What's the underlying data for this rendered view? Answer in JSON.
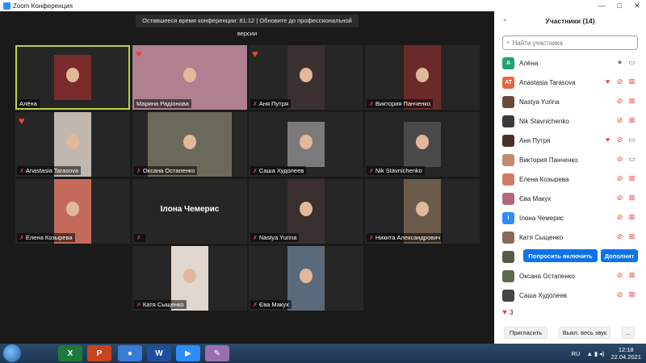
{
  "window": {
    "title": "Zoom Конференция",
    "controls": [
      "—",
      "□",
      "✕"
    ]
  },
  "banner": "Оставшееся время конференции: 81:12 | Обновите до профессиональной версии",
  "tiles": [
    {
      "name": "Алёна",
      "muted": false,
      "heart": false,
      "active": true,
      "pic": "small"
    },
    {
      "name": "Марина Радіонова",
      "muted": false,
      "heart": true,
      "active": false,
      "pic": "wide"
    },
    {
      "name": "Аня Путря",
      "muted": true,
      "heart": true,
      "active": false,
      "pic": "normal"
    },
    {
      "name": "Виктория Панченко",
      "muted": true,
      "heart": false,
      "active": false,
      "pic": "normal"
    },
    {
      "name": "Anastasia Tarasova",
      "muted": true,
      "heart": true,
      "active": false,
      "pic": "normal"
    },
    {
      "name": "Оксана Остапенко",
      "muted": true,
      "heart": false,
      "active": false,
      "pic": "mid"
    },
    {
      "name": "Саша Худолеев",
      "muted": true,
      "heart": false,
      "active": false,
      "pic": "small"
    },
    {
      "name": "Nik Stavnichenko",
      "muted": true,
      "heart": false,
      "active": false,
      "pic": "small"
    },
    {
      "name": "Елена Козырева",
      "muted": true,
      "heart": false,
      "active": false,
      "pic": "normal"
    },
    {
      "name": "",
      "bigname": "Ілона Чемерис",
      "muted": true,
      "heart": false,
      "active": false,
      "pic": "none"
    },
    {
      "name": "Nastya Yurina",
      "muted": true,
      "heart": false,
      "active": false,
      "pic": "normal"
    },
    {
      "name": "Никита Александрович",
      "muted": true,
      "heart": false,
      "active": false,
      "pic": "normal"
    },
    {
      "name": "Катя Сыщенко",
      "muted": true,
      "heart": false,
      "active": false,
      "pic": "normal"
    },
    {
      "name": "Єва Макух",
      "muted": true,
      "heart": false,
      "active": false,
      "pic": "normal"
    }
  ],
  "panel": {
    "title": "Участники (14)",
    "collapse_icon": "chevron-down-icon",
    "search_placeholder": "Найти участника",
    "participants": [
      {
        "name": "Алёна",
        "avatar_text": "A",
        "avatar_color": "#23a26d",
        "heart": false,
        "mic": "on",
        "cam": "on"
      },
      {
        "name": "Anastasia Tarasova",
        "avatar_text": "AT",
        "avatar_color": "#e8663c",
        "heart": true,
        "mic": "off",
        "cam": "off"
      },
      {
        "name": "Nastya Yurina",
        "avatar_text": "",
        "avatar_color": "#6b4a3a",
        "heart": false,
        "mic": "off",
        "cam": "off"
      },
      {
        "name": "Nik Stavnichenko",
        "avatar_text": "",
        "avatar_color": "#3a3a3a",
        "heart": false,
        "mic": "off",
        "cam": "off"
      },
      {
        "name": "Аня Путря",
        "avatar_text": "",
        "avatar_color": "#4a3028",
        "heart": true,
        "mic": "off",
        "cam": "on"
      },
      {
        "name": "Виктория Панченко",
        "avatar_text": "",
        "avatar_color": "#c48a70",
        "heart": false,
        "mic": "off",
        "cam": "on"
      },
      {
        "name": "Елена Козырева",
        "avatar_text": "",
        "avatar_color": "#d07a6a",
        "heart": false,
        "mic": "off",
        "cam": "off"
      },
      {
        "name": "Єва Макух",
        "avatar_text": "",
        "avatar_color": "#b5667a",
        "heart": false,
        "mic": "off",
        "cam": "off"
      },
      {
        "name": "Ілона Чемерис",
        "avatar_text": "I",
        "avatar_color": "#2d8cff",
        "heart": false,
        "mic": "off",
        "cam": "off"
      },
      {
        "name": "Катя Сыщенко",
        "avatar_text": "",
        "avatar_color": "#8a6a5a",
        "heart": false,
        "mic": "off",
        "cam": "off"
      },
      {
        "name": "",
        "avatar_text": "",
        "avatar_color": "#5a5a4a",
        "heart": false,
        "mic": "",
        "cam": "",
        "buttons": [
          "Попросить включить",
          "Дополнит"
        ]
      },
      {
        "name": "Оксана Остапенко",
        "avatar_text": "",
        "avatar_color": "#5a6a4a",
        "heart": false,
        "mic": "off",
        "cam": "off"
      },
      {
        "name": "Саша Худолеев",
        "avatar_text": "",
        "avatar_color": "#444444",
        "heart": false,
        "mic": "off",
        "cam": "off"
      }
    ],
    "reactions_count": "3",
    "footer": {
      "invite": "Пригласить",
      "mute_all": "Выкл. весь звук",
      "more": "..."
    }
  },
  "taskbar": {
    "language": "RU",
    "time": "12:18",
    "date": "22.04.2021",
    "apps": [
      {
        "label": "X",
        "color": "#1d7a3c",
        "icon": "excel-icon"
      },
      {
        "label": "P",
        "color": "#c8431f",
        "icon": "powerpoint-icon"
      },
      {
        "label": "●",
        "color": "#3a7bd5",
        "icon": "chrome-icon"
      },
      {
        "label": "W",
        "color": "#1e4f9c",
        "icon": "word-icon"
      },
      {
        "label": "▶",
        "color": "#2d8cff",
        "icon": "zoom-icon"
      },
      {
        "label": "✎",
        "color": "#9a6fb0",
        "icon": "paint-icon"
      }
    ]
  },
  "colors": {
    "accent": "#0e72ed",
    "active_border": "#b7d542",
    "mute_red": "#e8453c"
  }
}
